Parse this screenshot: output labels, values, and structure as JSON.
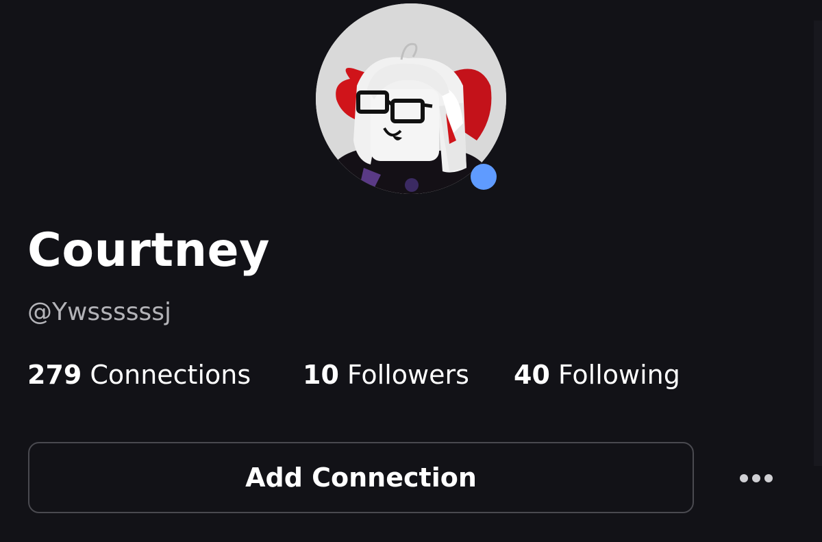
{
  "profile": {
    "display_name": "Courtney",
    "username": "@Ywssssssj",
    "presence_color": "#5f9bff",
    "avatar_icon": "avatar-thumbnail"
  },
  "stats": [
    {
      "count": "279",
      "label": "Connections"
    },
    {
      "count": "10",
      "label": "Followers"
    },
    {
      "count": "40",
      "label": "Following"
    }
  ],
  "actions": {
    "add_connection_label": "Add Connection",
    "more_icon": "ellipsis-icon"
  },
  "colors": {
    "background": "#121217",
    "text": "#ffffff",
    "muted_text": "#b3b3b8",
    "button_border": "#4a4a50"
  }
}
